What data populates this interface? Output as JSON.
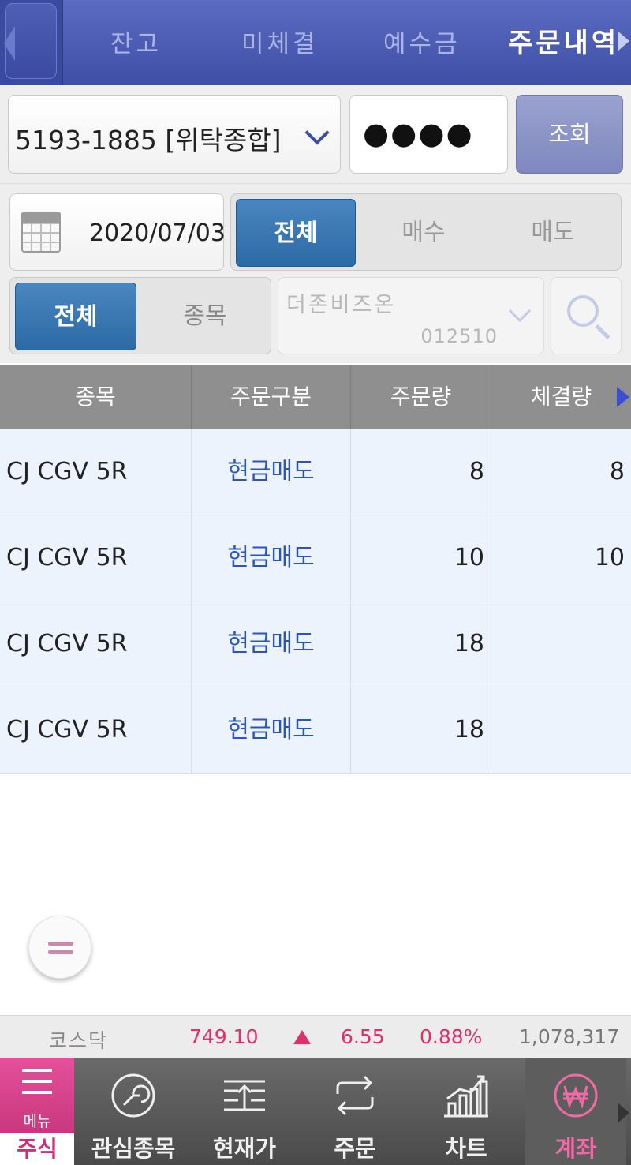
{
  "top_tabs": [
    {
      "label": "잔고"
    },
    {
      "label": "미체결"
    },
    {
      "label": "예수금"
    },
    {
      "label": "주문내역",
      "active": true
    }
  ],
  "account": {
    "selected": "5193-1885 [위탁종합]",
    "password_mask": "●●●●",
    "query_label": "조회"
  },
  "filters": {
    "date": "2020/07/03",
    "trade_type": [
      "전체",
      "매수",
      "매도"
    ],
    "trade_type_selected": "전체",
    "scope": [
      "전체",
      "종목"
    ],
    "scope_selected": "전체",
    "stock_name": "더존비즈온",
    "stock_code": "012510"
  },
  "table": {
    "columns": [
      "종목",
      "주문구분",
      "주문량",
      "체결량"
    ],
    "rows": [
      {
        "name": "CJ CGV 5R",
        "type": "현금매도",
        "qty": "8",
        "filled": "8"
      },
      {
        "name": "CJ CGV 5R",
        "type": "현금매도",
        "qty": "10",
        "filled": "10"
      },
      {
        "name": "CJ CGV 5R",
        "type": "현금매도",
        "qty": "18",
        "filled": ""
      },
      {
        "name": "CJ CGV 5R",
        "type": "현금매도",
        "qty": "18",
        "filled": ""
      }
    ]
  },
  "ticker": {
    "market": "코스닥",
    "index": "749.10",
    "change": "6.55",
    "change_pct": "0.88%",
    "volume": "1,078,317",
    "direction": "up",
    "color_up": "#e0306c"
  },
  "bottom_nav": {
    "menu_label": "메뉴",
    "section_label": "주식",
    "items": [
      {
        "label": "관심종목",
        "icon": "watchlist-icon"
      },
      {
        "label": "현재가",
        "icon": "price-icon"
      },
      {
        "label": "주문",
        "icon": "order-icon"
      },
      {
        "label": "차트",
        "icon": "chart-icon"
      },
      {
        "label": "계좌",
        "icon": "won-icon",
        "active": true
      }
    ]
  }
}
